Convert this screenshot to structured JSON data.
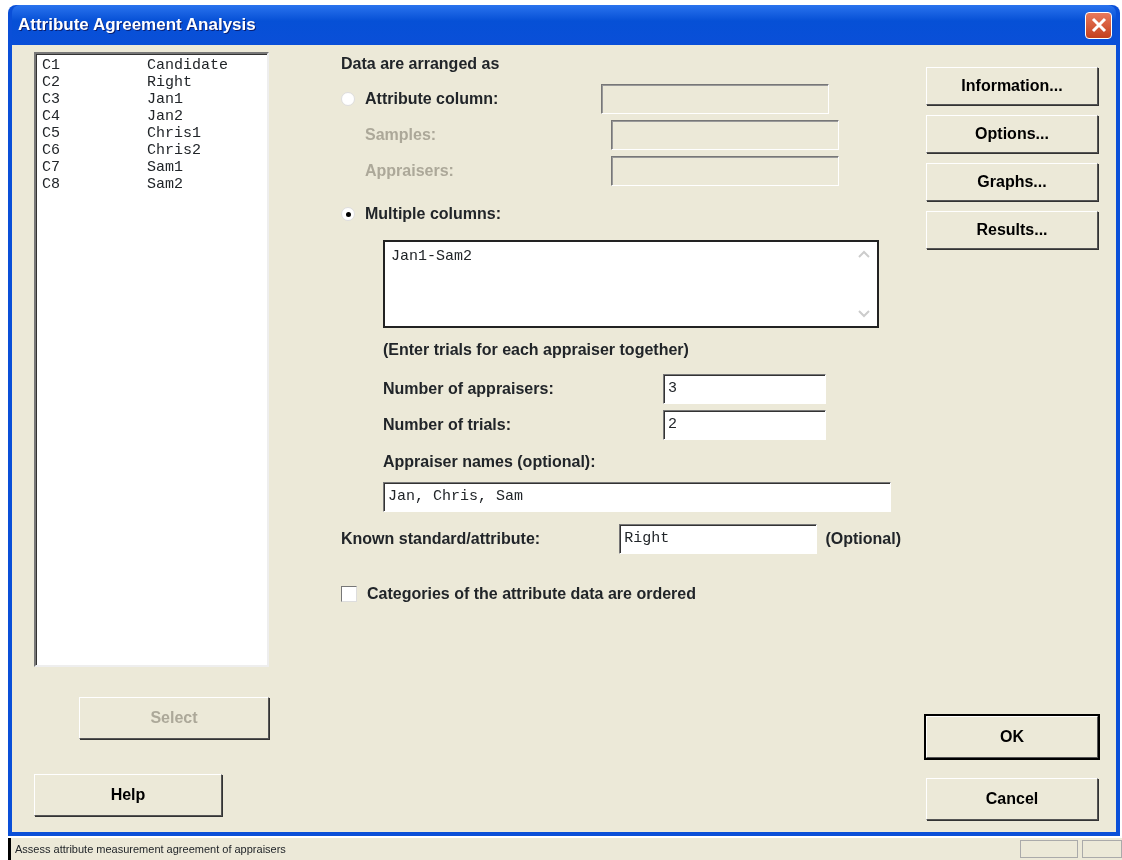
{
  "window": {
    "title": "Attribute Agreement Analysis"
  },
  "columns_list": [
    {
      "number": "C1",
      "name": "Candidate"
    },
    {
      "number": "C2",
      "name": "Right"
    },
    {
      "number": "C3",
      "name": "Jan1"
    },
    {
      "number": "C4",
      "name": "Jan2"
    },
    {
      "number": "C5",
      "name": "Chris1"
    },
    {
      "number": "C6",
      "name": "Chris2"
    },
    {
      "number": "C7",
      "name": "Sam1"
    },
    {
      "number": "C8",
      "name": "Sam2"
    }
  ],
  "select_button": {
    "label": "Select",
    "disabled": true
  },
  "help_button": {
    "label": "Help"
  },
  "arrangement_heading": "Data are arranged as",
  "attribute_option": {
    "label": "Attribute column:",
    "selected": false
  },
  "sub_fields": [
    {
      "label": "Samples:",
      "disabled": true
    },
    {
      "label": "Appraisers:",
      "disabled": true
    }
  ],
  "multiple_option": {
    "label": "Multiple columns:",
    "selected": true,
    "value": "Jan1-Sam2"
  },
  "note": "(Enter trials for each appraiser together)",
  "number_fields": [
    {
      "label": "Number of appraisers:",
      "value": "3"
    },
    {
      "label": "Number of trials:",
      "value": "2"
    }
  ],
  "appraiser_names": {
    "label": "Appraiser names (optional):",
    "value": "Jan, Chris, Sam"
  },
  "known_standard": {
    "label": "Known standard/attribute:",
    "value": "Right",
    "hint": "(Optional)"
  },
  "ordered_checkbox": {
    "label": "Categories of the attribute data are ordered",
    "checked": false
  },
  "side_buttons": [
    "Information...",
    "Options...",
    "Graphs...",
    "Results..."
  ],
  "ok_button": {
    "label": "OK",
    "default": true
  },
  "cancel_button": {
    "label": "Cancel",
    "default": false
  },
  "status_bar": "Assess attribute measurement agreement of appraisers"
}
